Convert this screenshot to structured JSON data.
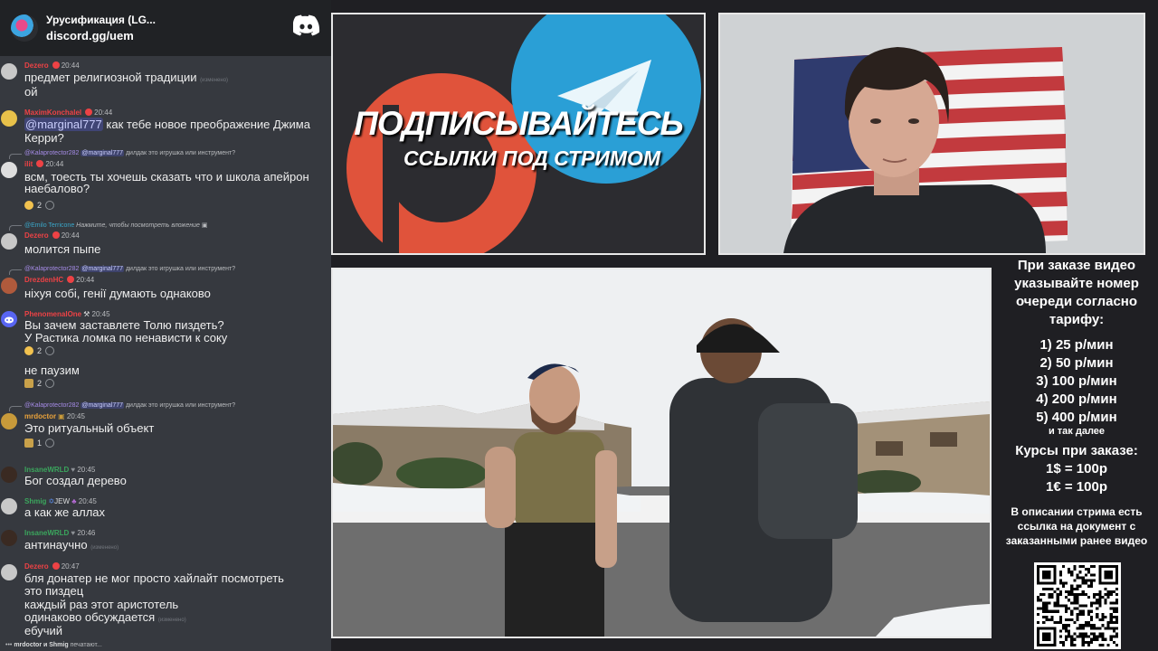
{
  "chat": {
    "server_name": "Урусификация (LG...",
    "server_invite": "discord.gg/uem",
    "typing": {
      "names": "mrdoctor и Shmig",
      "suffix": "печатают..."
    },
    "messages": [
      {
        "author": "Dezero",
        "author_color": "#ed4245",
        "time": "20:44",
        "lines": [
          "предмет религиозной традиции",
          "ой"
        ],
        "edited": "(изменено)"
      },
      {
        "author": "MaximKonchalel",
        "author_color": "#ed4245",
        "time": "20:44",
        "mention": "@marginal777",
        "lines": [
          "как тебе новое преображение Джима",
          "Керри?"
        ]
      },
      {
        "reply_author": "@Kalaprotector282",
        "reply_mention": "@marginal777",
        "reply_text": "дилдак это игрушка или инструмент?",
        "author": "ilit",
        "author_color": "#ed4245",
        "time": "20:44",
        "lines": [
          "всм, тоесть ты хочешь сказать что и школа апейрон",
          "наебалово?"
        ],
        "reaction_count": "2"
      },
      {
        "reply_author": "@Emilo Terricone",
        "reply_text": "Нажмите, чтобы посмотреть вложение",
        "author": "Dezero",
        "author_color": "#ed4245",
        "time": "20:44",
        "lines": [
          "молится пыпе"
        ]
      },
      {
        "reply_author": "@Kalaprotector282",
        "reply_mention": "@marginal777",
        "reply_text": "дилдак это игрушка или инструмент?",
        "author": "DrezdenHC",
        "author_color": "#ed4245",
        "time": "20:44",
        "lines": [
          "ніхуя собі, генії думають однаково"
        ]
      },
      {
        "author": "PhenomenalOne",
        "author_color": "#ed4245",
        "time": "20:45",
        "lines": [
          "Вы зачем заставлете Толю пиздеть?",
          "У Растика ломка по ненависти к соку"
        ],
        "reaction_count": "2",
        "extra_line": "не паузим",
        "extra_reaction_count": "2"
      },
      {
        "reply_author": "@Kalaprotector282",
        "reply_mention": "@marginal777",
        "reply_text": "дилдак это игрушка или инструмент?",
        "author": "mrdoctor",
        "author_color": "#e9a23b",
        "time": "20:45",
        "lines": [
          "Это ритуальный объект"
        ],
        "reaction_count": "1"
      },
      {
        "author": "InsaneWRLD",
        "author_color": "#3ba55d",
        "time": "20:45",
        "lines": [
          "Бог создал дерево"
        ]
      },
      {
        "author": "Shmig",
        "author_color": "#3ba55d",
        "badge": "JEW",
        "time": "20:45",
        "lines": [
          "а как же аллах"
        ]
      },
      {
        "author": "InsaneWRLD",
        "author_color": "#3ba55d",
        "time": "20:46",
        "lines": [
          "антинаучно"
        ],
        "edited": "(изменено)"
      },
      {
        "author": "Dezero",
        "author_color": "#ed4245",
        "time": "20:47",
        "lines": [
          "бля донатер не мог просто хайлайт посмотреть",
          "это пиздец",
          "каждый раз этот аристотель",
          "одинаково обсуждается",
          "ебучий"
        ],
        "edited": "(изменено)"
      }
    ]
  },
  "promo": {
    "title": "ПОДПИСЫВАЙТЕСЬ",
    "subtitle": "ССЫЛКИ ПОД СТРИМОМ",
    "patreon_color": "#e0533b",
    "telegram_color": "#2a9fd6"
  },
  "info": {
    "order_heading": "При заказе видео указывайте номер очереди согласно тарифу:",
    "tariffs": [
      "1) 25 р/мин",
      "2) 50 р/мин",
      "3) 100 р/мин",
      "4) 200 р/мин",
      "5) 400 р/мин"
    ],
    "and_more": "и так далее",
    "rates_heading": "Курсы при заказе:",
    "rates": [
      "1$ = 100р",
      "1€ = 100р"
    ],
    "desc_note": "В описании стрима есть ссылка на документ с заказанными ранее видео"
  }
}
